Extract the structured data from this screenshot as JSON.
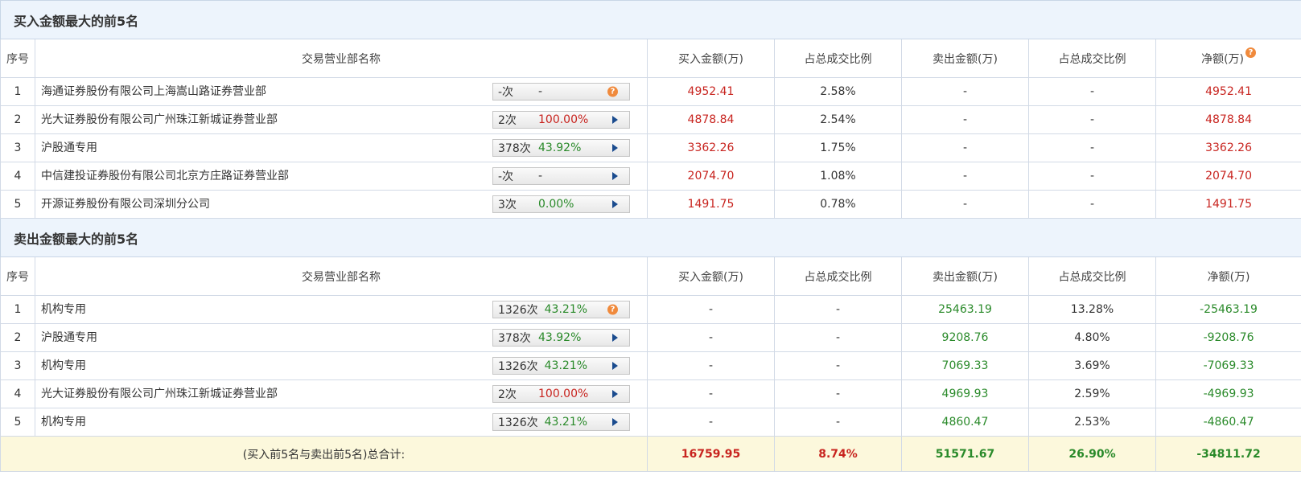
{
  "buy_section": {
    "title": "买入金额最大的前5名",
    "headers": [
      "序号",
      "交易营业部名称",
      "买入金额(万)",
      "占总成交比例",
      "卖出金额(万)",
      "占总成交比例",
      "净额(万)"
    ],
    "rows": [
      {
        "idx": "1",
        "name": "海通证券股份有限公司上海嵩山路证券营业部",
        "count": "-次",
        "pct": "-",
        "pct_color": "gray",
        "icon": "question",
        "buy": "4952.41",
        "buy_ratio": "2.58%",
        "sell": "-",
        "sell_ratio": "-",
        "net": "4952.41",
        "net_color": "red"
      },
      {
        "idx": "2",
        "name": "光大证券股份有限公司广州珠江新城证券营业部",
        "count": "2次",
        "pct": "100.00%",
        "pct_color": "red",
        "icon": "arrow",
        "buy": "4878.84",
        "buy_ratio": "2.54%",
        "sell": "-",
        "sell_ratio": "-",
        "net": "4878.84",
        "net_color": "red"
      },
      {
        "idx": "3",
        "name": "沪股通专用",
        "count": "378次",
        "pct": "43.92%",
        "pct_color": "green",
        "icon": "arrow",
        "buy": "3362.26",
        "buy_ratio": "1.75%",
        "sell": "-",
        "sell_ratio": "-",
        "net": "3362.26",
        "net_color": "red"
      },
      {
        "idx": "4",
        "name": "中信建投证券股份有限公司北京方庄路证券营业部",
        "count": "-次",
        "pct": "-",
        "pct_color": "gray",
        "icon": "arrow",
        "buy": "2074.70",
        "buy_ratio": "1.08%",
        "sell": "-",
        "sell_ratio": "-",
        "net": "2074.70",
        "net_color": "red"
      },
      {
        "idx": "5",
        "name": "开源证券股份有限公司深圳分公司",
        "count": "3次",
        "pct": "0.00%",
        "pct_color": "green",
        "icon": "arrow",
        "buy": "1491.75",
        "buy_ratio": "0.78%",
        "sell": "-",
        "sell_ratio": "-",
        "net": "1491.75",
        "net_color": "red"
      }
    ]
  },
  "sell_section": {
    "title": "卖出金额最大的前5名",
    "headers": [
      "序号",
      "交易营业部名称",
      "买入金额(万)",
      "占总成交比例",
      "卖出金额(万)",
      "占总成交比例",
      "净额(万)"
    ],
    "rows": [
      {
        "idx": "1",
        "name": "机构专用",
        "count": "1326次",
        "pct": "43.21%",
        "pct_color": "green",
        "icon": "question",
        "buy": "-",
        "buy_ratio": "-",
        "sell": "25463.19",
        "sell_ratio": "13.28%",
        "net": "-25463.19",
        "net_color": "green"
      },
      {
        "idx": "2",
        "name": "沪股通专用",
        "count": "378次",
        "pct": "43.92%",
        "pct_color": "green",
        "icon": "arrow",
        "buy": "-",
        "buy_ratio": "-",
        "sell": "9208.76",
        "sell_ratio": "4.80%",
        "net": "-9208.76",
        "net_color": "green"
      },
      {
        "idx": "3",
        "name": "机构专用",
        "count": "1326次",
        "pct": "43.21%",
        "pct_color": "green",
        "icon": "arrow",
        "buy": "-",
        "buy_ratio": "-",
        "sell": "7069.33",
        "sell_ratio": "3.69%",
        "net": "-7069.33",
        "net_color": "green"
      },
      {
        "idx": "4",
        "name": "光大证券股份有限公司广州珠江新城证券营业部",
        "count": "2次",
        "pct": "100.00%",
        "pct_color": "red",
        "icon": "arrow",
        "buy": "-",
        "buy_ratio": "-",
        "sell": "4969.93",
        "sell_ratio": "2.59%",
        "net": "-4969.93",
        "net_color": "green"
      },
      {
        "idx": "5",
        "name": "机构专用",
        "count": "1326次",
        "pct": "43.21%",
        "pct_color": "green",
        "icon": "arrow",
        "buy": "-",
        "buy_ratio": "-",
        "sell": "4860.47",
        "sell_ratio": "2.53%",
        "net": "-4860.47",
        "net_color": "green"
      }
    ]
  },
  "total": {
    "label": "(买入前5名与卖出前5名)总合计:",
    "buy": "16759.95",
    "buy_ratio": "8.74%",
    "sell": "51571.67",
    "sell_ratio": "26.90%",
    "net": "-34811.72"
  },
  "help_icon_glyph": "?",
  "colors": {
    "red": "#c8241f",
    "green": "#2a8a2a",
    "gray": "#555555",
    "accent_bg": "#edf4fc",
    "total_bg": "#fcf8dc"
  }
}
